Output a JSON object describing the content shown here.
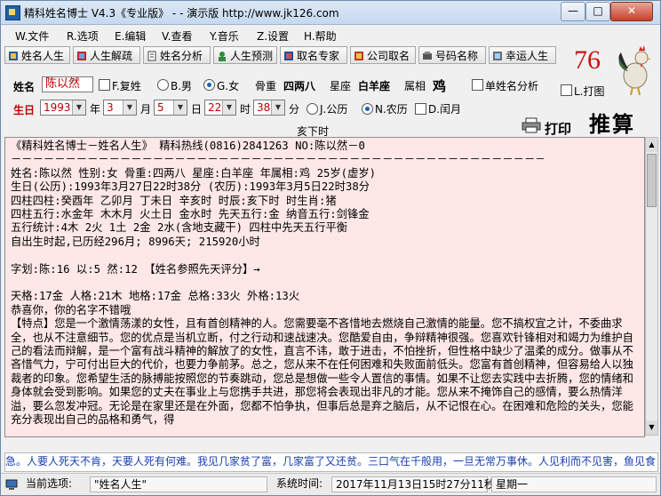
{
  "window": {
    "title": "精科姓名博士  V4.3《专业版》 - - 演示版  http://www.jk126.com",
    "min_label": "—",
    "max_label": "□",
    "close_label": "✕"
  },
  "menu": [
    {
      "label": "W.文件"
    },
    {
      "label": "R.选项"
    },
    {
      "label": "E.编辑"
    },
    {
      "label": "V.查看"
    },
    {
      "label": "Y.音乐"
    },
    {
      "label": "Z.设置"
    },
    {
      "label": "H.帮助"
    }
  ],
  "toolbar": [
    {
      "label": "姓名人生",
      "icon": "book-icon"
    },
    {
      "label": "人生解疏",
      "icon": "book-icon"
    },
    {
      "label": "姓名分析",
      "icon": "document-icon"
    },
    {
      "label": "人生预测",
      "icon": "person-icon"
    },
    {
      "label": "取名专家",
      "icon": "book-icon"
    },
    {
      "label": "公司取名",
      "icon": "book-icon"
    },
    {
      "label": "号码名称",
      "icon": "phone-icon"
    },
    {
      "label": "幸运人生",
      "icon": "book-icon"
    }
  ],
  "score": "76",
  "name_row": {
    "name_label": "姓名",
    "name_value": "陈以然",
    "compound_surname": "F.复姓",
    "male": "B.男",
    "female": "G.女",
    "gender_selected": "female",
    "bone_weight_label": "骨重",
    "bone_weight_value": "四两八",
    "zodiac_label": "星座",
    "zodiac_value": "白羊座",
    "animal_label": "属相",
    "animal_value": "鸡",
    "single_name_analysis": "单姓名分析",
    "print_option": "L.打图"
  },
  "birth_row": {
    "label": "生日",
    "year": "1993",
    "year_unit": "年",
    "month": "3",
    "month_unit": "月",
    "day": "5",
    "day_unit": "日",
    "hour": "22",
    "hour_unit": "时",
    "minute": "38",
    "minute_unit": "分",
    "solar": "J.公历",
    "lunar": "N.农历",
    "calendar_selected": "lunar",
    "leap_month": "D.闰月"
  },
  "hour_label": "亥下时",
  "print_label": "打印",
  "calculate_label": "推算",
  "result_lines": [
    "《精科姓名博士－姓名人生》  精科热线(0816)2841263  NO:陈以然－0",
    "－－－－－－－－－－－－－－－－－－－－－－－－－－－－－－－－－－－－－－－－－－－－－－－－－－－－－－－－－－－",
    "姓名:陈以然 性别:女 骨重:四两八 星座:白羊座 年属相:鸡 25岁(虚岁)",
    "生日(公历):1993年3月27日22时38分  (农历):1993年3月5日22时38分",
    "四柱四柱:癸酉年 乙卯月 丁未日 辛亥时 时辰:亥下时  时生肖:猪",
    "四柱五行:水金年 木木月 火土日 金水时 先天五行:金  纳音五行:剑锋金",
    "五行统计:4木 2火 1土 2金 2水(含地支藏干) 四柱中先天五行平衡",
    "自出生时起,已历经296月; 8996天; 215920小时",
    "",
    "字划:陈:16 以:5 然:12      【姓名参照先天评分】→",
    "",
    "天格:17金 人格:21木 地格:17金 总格:33火 外格:13火",
    "                                   恭喜你，你的名字不错哦",
    "    【特点】您是一个激情荡漾的女性，且有首创精神的人。您需要毫不吝惜地去燃烧自己激情的能量。您不搞权宜之计，不委曲求全，也从不注意细节。您的优点是当机立断，付之行动和速战速决。您酷爱自由，争辩精神很强。您喜欢针锋相对和竭力为维护自己的看法而辩解，是一个富有战斗精神的解放了的女性，直言不讳，敢于进击，不怕挫折，但性格中缺少了温柔的成分。做事从不吝惜气力，宁可付出巨大的代价，也要力争前茅。总之，您从来不在任何困难和失败面前低头。您富有首创精神，但容易给人以独裁者的印象。您希望生活的脉搏能按照您的节奏跳动，您总是想做一些令人置信的事情。如果不让您去实践中去折腾，您的情绪和身体就会受到影响。如果您的丈夫在事业上与您携手共进，那您将会表现出非凡的才能。您从来不掩饰自己的感情，要么热情洋溢，要么忽发冲冠。无论是在家里还是在外面，您都不怕争执，但事后总是弃之脑后，从不记恨在心。在困难和危险的关头，您能充分表现出自己的品格和勇气，得"
  ],
  "ticker": "急。人要人死天不肯，天要人死有何难。我见几家贫了富，几家富了又还贫。三口气在千般用，一旦无常万事休。人见利而不见害，鱼见食",
  "status": {
    "current_option_label": "当前选项:",
    "current_option_value": "\"姓名人生\"",
    "system_time_label": "系统时间:",
    "system_time_value": "2017年11月13日15时27分11秒",
    "weekday_label": "星期一"
  }
}
